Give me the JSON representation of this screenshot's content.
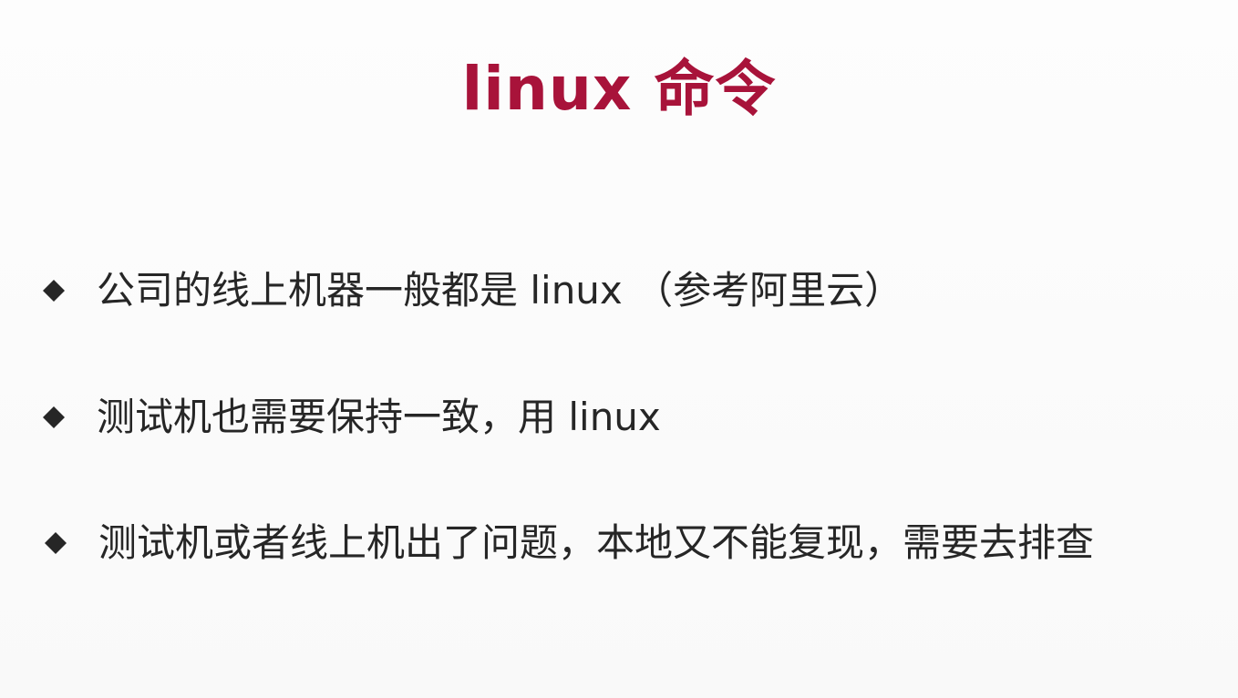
{
  "slide": {
    "title": "linux 命令",
    "bullets": [
      "公司的线上机器一般都是 linux （参考阿里云）",
      "测试机也需要保持一致，用 linux",
      "测试机或者线上机出了问题，本地又不能复现，需要去排查"
    ]
  },
  "colors": {
    "title": "#a8133a",
    "text": "#262626",
    "bullet": "#262626",
    "background": "#fbfbfb"
  },
  "icons": {
    "bullet": "diamond-bullet-icon"
  }
}
